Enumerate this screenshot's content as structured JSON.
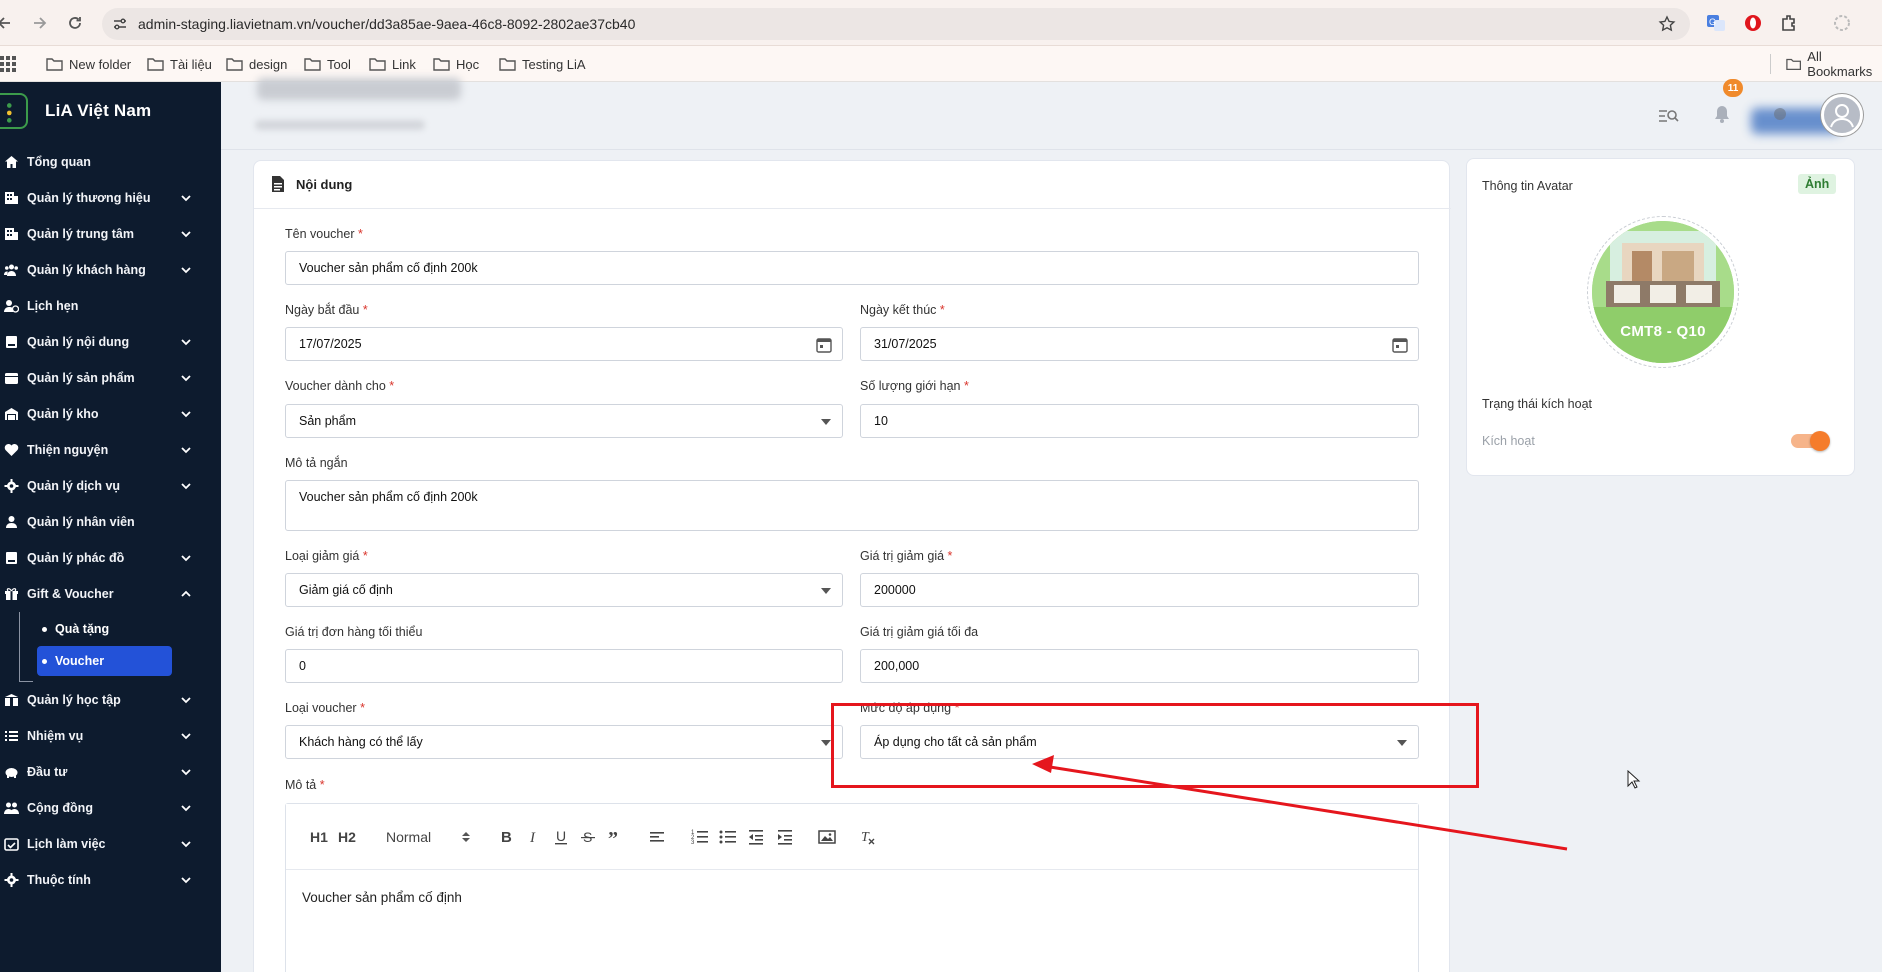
{
  "browser": {
    "url": "admin-staging.liavietnam.vn/voucher/dd3a85ae-9aea-46c8-8092-2802ae37cb40",
    "bookmarks": [
      "New folder",
      "Tài liệu",
      "design",
      "Tool",
      "Link",
      "Học",
      "Testing LiA"
    ],
    "all_bookmarks": "All Bookmarks"
  },
  "sidebar": {
    "brand": "LiA Việt Nam",
    "items": [
      {
        "label": "Tổng quan",
        "icon": "home-icon"
      },
      {
        "label": "Quản lý thương hiệu",
        "icon": "building-icon"
      },
      {
        "label": "Quản lý trung tâm",
        "icon": "building-icon"
      },
      {
        "label": "Quản lý khách hàng",
        "icon": "users-icon"
      },
      {
        "label": "Lịch hẹn",
        "icon": "user-clock-icon"
      },
      {
        "label": "Quản lý nội dung",
        "icon": "book-icon"
      },
      {
        "label": "Quản lý sản phẩm",
        "icon": "calendar-icon"
      },
      {
        "label": "Quản lý kho",
        "icon": "warehouse-icon"
      },
      {
        "label": "Thiện nguyện",
        "icon": "heart-icon"
      },
      {
        "label": "Quản lý dịch vụ",
        "icon": "gear-icon"
      },
      {
        "label": "Quản lý nhân viên",
        "icon": "user-icon"
      },
      {
        "label": "Quản lý phác đồ",
        "icon": "book-icon"
      },
      {
        "label": "Gift & Voucher",
        "icon": "gift-icon"
      }
    ],
    "sub_items": [
      {
        "label": "Quà tặng",
        "active": false
      },
      {
        "label": "Voucher",
        "active": true
      }
    ],
    "items_after": [
      {
        "label": "Quản lý học tập",
        "icon": "graduation-icon"
      },
      {
        "label": "Nhiệm vụ",
        "icon": "list-icon"
      },
      {
        "label": "Đầu tư",
        "icon": "piggy-icon"
      },
      {
        "label": "Cộng đồng",
        "icon": "people-icon"
      },
      {
        "label": "Lịch làm việc",
        "icon": "calendar-check-icon"
      },
      {
        "label": "Thuộc tính",
        "icon": "gear-icon"
      }
    ]
  },
  "header": {
    "notification_count": "11"
  },
  "content": {
    "section_title": "Nội dung",
    "fields": {
      "name": {
        "label": "Tên voucher",
        "value": "Voucher sản phẩm cố định 200k"
      },
      "start_date": {
        "label": "Ngày bắt đầu",
        "value": "17/07/2025"
      },
      "end_date": {
        "label": "Ngày kết thúc",
        "value": "31/07/2025"
      },
      "target": {
        "label": "Voucher dành cho",
        "value": "Sản phẩm"
      },
      "limit": {
        "label": "Số lượng giới hạn",
        "value": "10"
      },
      "short_desc": {
        "label": "Mô tả ngắn",
        "value": "Voucher sản phẩm cố định 200k"
      },
      "discount_type": {
        "label": "Loại giảm giá",
        "value": "Giảm giá cố định"
      },
      "discount_value": {
        "label": "Giá trị giảm giá",
        "value": "200000"
      },
      "min_order": {
        "label": "Giá trị đơn hàng tối thiểu",
        "value": "0"
      },
      "max_discount": {
        "label": "Giá trị giảm giá tối đa",
        "value": "200,000"
      },
      "voucher_type": {
        "label": "Loại voucher",
        "value": "Khách hàng có thể lấy"
      },
      "apply_level": {
        "label": "Mức độ áp dụng",
        "value": "Áp dụng cho tất cả sản phẩm"
      },
      "description": {
        "label": "Mô tả",
        "value": "Voucher sản phẩm cố định"
      }
    },
    "editor": {
      "font_select": "Normal",
      "h1": "H1",
      "h2": "H2"
    }
  },
  "avatar_panel": {
    "title": "Thông tin Avatar",
    "badge": "Ảnh",
    "image_text": "CMT8 - Q10",
    "status_title": "Trạng thái kích hoạt",
    "status_label": "Kích hoạt",
    "active": true
  },
  "colors": {
    "sidebar_bg": "#0d1b2e",
    "active_item": "#2352d8",
    "toggle_on": "#f57c2b",
    "annotation": "#e5161d"
  }
}
